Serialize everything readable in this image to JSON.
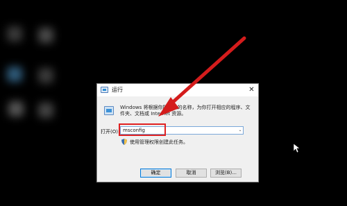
{
  "dialog": {
    "title": "运行",
    "close_glyph": "✕",
    "description": "Windows 将根据你所输入的名称，为你打开相应的程序、文件夹、文档或 Internet 资源。",
    "open_label": "打开(O):",
    "open_value": "msconfig",
    "admin_note": "使用管理权限创建此任务。",
    "buttons": {
      "ok": "确定",
      "cancel": "取消",
      "browse": "浏览(B)..."
    }
  },
  "colors": {
    "highlight": "#e02020",
    "arrow": "#d41c1c",
    "accent_border": "#0078d7"
  },
  "icons": [
    "run-icon",
    "close-icon",
    "dropdown-arrow-icon",
    "shield-icon",
    "mouse-cursor-icon"
  ]
}
